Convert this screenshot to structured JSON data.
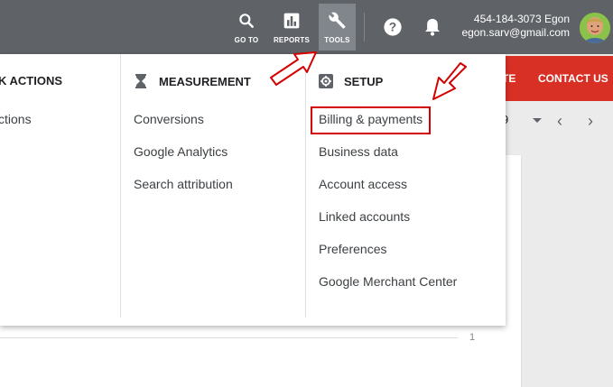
{
  "topbar": {
    "goto_label": "GO TO",
    "reports_label": "REPORTS",
    "tools_label": "TOOLS",
    "account_id": "454-184-3073 Egon",
    "account_email": "egon.sarv@gmail.com",
    "icons": {
      "goto": "search-icon",
      "reports": "bar-chart-icon",
      "tools": "wrench-icon",
      "help": "help-icon",
      "notifications": "bell-icon"
    }
  },
  "background": {
    "red_left_text": "TE",
    "contact_label": "CONTACT US",
    "date_value": "9",
    "page_number": "1"
  },
  "menu": {
    "columns": [
      {
        "header": "K ACTIONS",
        "items": [
          "ctions"
        ]
      },
      {
        "header": "MEASUREMENT",
        "icon": "hourglass-icon",
        "items": [
          "Conversions",
          "Google Analytics",
          "Search attribution"
        ]
      },
      {
        "header": "SETUP",
        "icon": "gear-icon",
        "items": [
          "Billing & payments",
          "Business data",
          "Account access",
          "Linked accounts",
          "Preferences",
          "Google Merchant Center"
        ]
      }
    ]
  },
  "annotations": {
    "highlight_color": "#d50000",
    "highlighted_item": "Billing & payments"
  }
}
